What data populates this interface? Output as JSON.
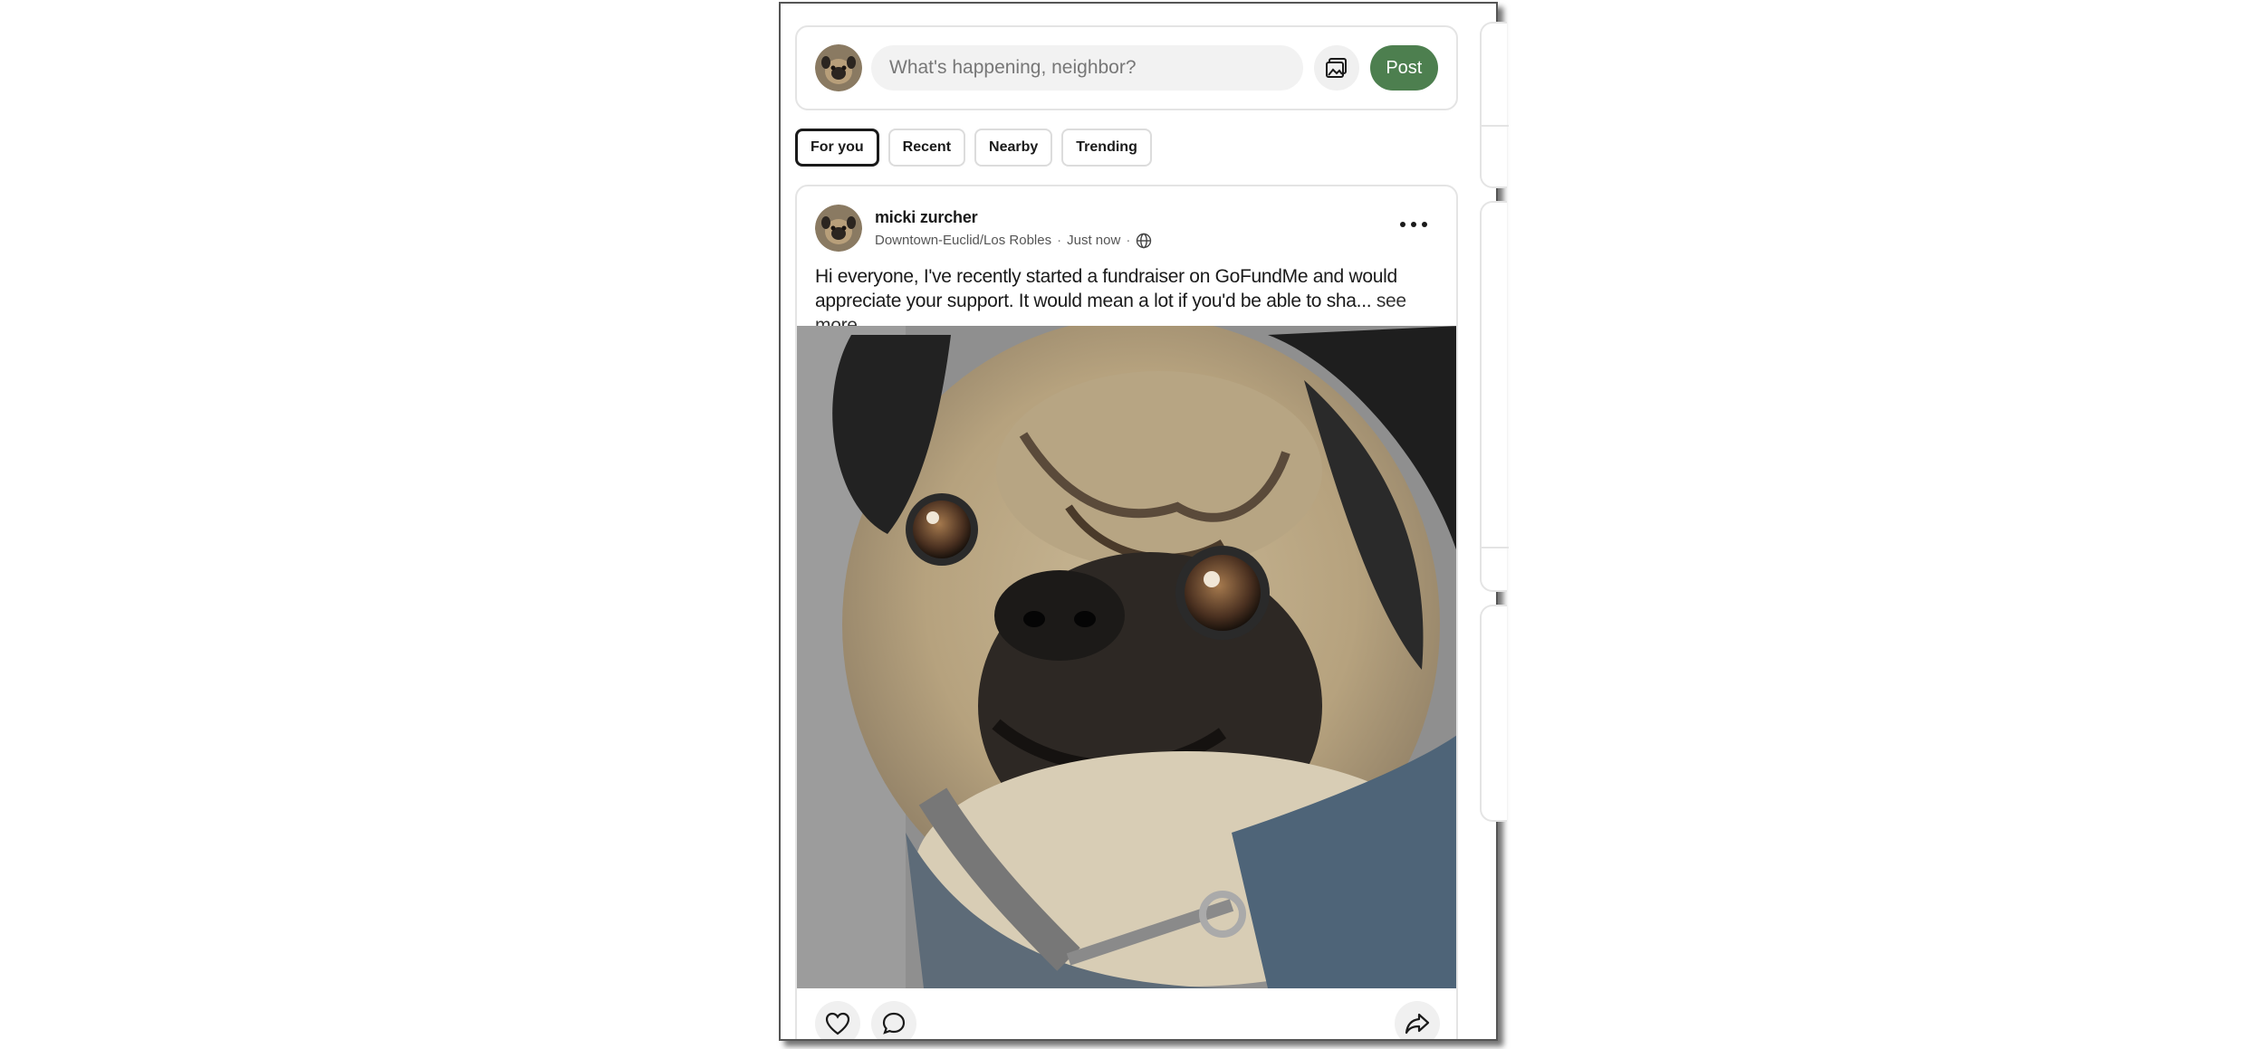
{
  "composer": {
    "placeholder": "What's happening, neighbor?",
    "post_label": "Post",
    "photo_icon": "photo-icon"
  },
  "tabs": [
    {
      "label": "For you",
      "active": true
    },
    {
      "label": "Recent",
      "active": false
    },
    {
      "label": "Nearby",
      "active": false
    },
    {
      "label": "Trending",
      "active": false
    }
  ],
  "post": {
    "author": "micki zurcher",
    "location": "Downtown-Euclid/Los Robles",
    "time": "Just now",
    "visibility_icon": "globe-icon",
    "text": "Hi everyone, I've recently started a fundraiser on GoFundMe and would appreciate your support. It would mean a lot if you'd be able to sha...",
    "see_more": "see more",
    "image_alt": "pug"
  },
  "actions": {
    "like_icon": "heart-icon",
    "comment_icon": "comment-icon",
    "share_icon": "share-icon"
  },
  "colors": {
    "accent": "#4d7f4f",
    "card_border": "#e4e4e4"
  }
}
